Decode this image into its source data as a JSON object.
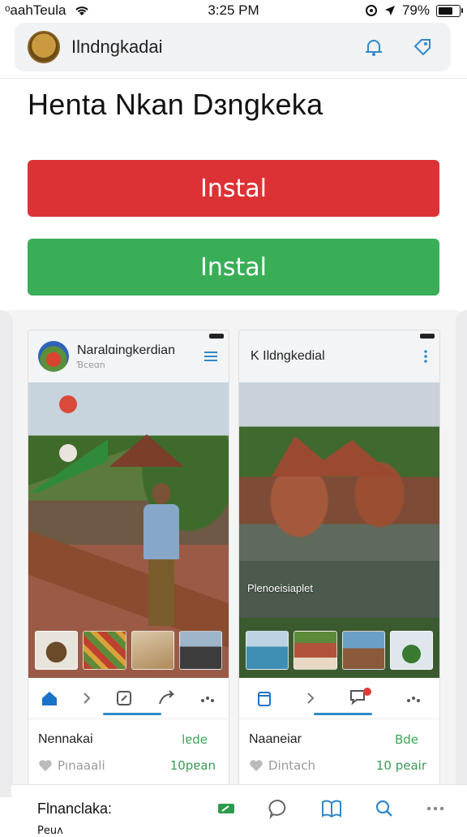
{
  "status_bar": {
    "carrier": "ᵒaahTeula",
    "time": "3:25 PM",
    "battery": "79%",
    "battery_level": 0.79
  },
  "app_header": {
    "title": "Ilndngkadai",
    "icons": [
      "bell-icon",
      "tag-icon"
    ]
  },
  "page": {
    "heading": "Henta Nkan Dɜngkeka"
  },
  "buttons": {
    "primary_red": "Instal",
    "primary_green": "Instal"
  },
  "colors": {
    "red_button": "#dc3236",
    "green_button": "#3aae57",
    "accent_blue": "#2f89c9"
  },
  "cards": [
    {
      "title": "Naralɑingkerdian",
      "subtitle": "Ɓcɐɑn",
      "photo_caption": "",
      "footer_name": "Nennakai",
      "footer_tag": "lɐde",
      "footer_sub": "Pınaaali",
      "footer_meta": "10pɐan"
    },
    {
      "title": "K Ildngkedial",
      "subtitle": "",
      "photo_caption": "Plenoeisiaplet",
      "footer_name": "Naaneiar",
      "footer_tag": "Bde",
      "footer_sub": "Dintach",
      "footer_meta": "10 peair"
    }
  ],
  "bottom_nav": {
    "title": "Flnanclaka:",
    "extra": "Рeuᴧ",
    "icons": [
      "edit-icon",
      "chat-bubble-icon",
      "book-icon",
      "search-icon",
      "more-icon"
    ]
  }
}
